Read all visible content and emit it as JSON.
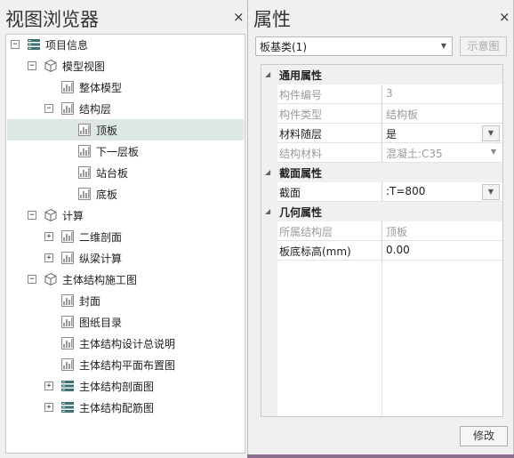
{
  "left_panel": {
    "title": "视图浏览器",
    "close": "×",
    "tree": [
      {
        "label": "项目信息",
        "depth": 0,
        "expander": "−",
        "icon": "info-list-icon"
      },
      {
        "label": "模型视图",
        "depth": 1,
        "expander": "−",
        "icon": "cube-icon"
      },
      {
        "label": "整体模型",
        "depth": 2,
        "expander": "",
        "icon": "view-icon"
      },
      {
        "label": "结构层",
        "depth": 2,
        "expander": "−",
        "icon": "view-icon"
      },
      {
        "label": "顶板",
        "depth": 3,
        "expander": "",
        "icon": "view-icon",
        "selected": true
      },
      {
        "label": "下一层板",
        "depth": 3,
        "expander": "",
        "icon": "view-icon"
      },
      {
        "label": "站台板",
        "depth": 3,
        "expander": "",
        "icon": "view-icon"
      },
      {
        "label": "底板",
        "depth": 3,
        "expander": "",
        "icon": "view-icon"
      },
      {
        "label": "计算",
        "depth": 1,
        "expander": "−",
        "icon": "cube-icon"
      },
      {
        "label": "二维剖面",
        "depth": 2,
        "expander": "+",
        "icon": "view-icon"
      },
      {
        "label": "纵梁计算",
        "depth": 2,
        "expander": "+",
        "icon": "view-icon"
      },
      {
        "label": "主体结构施工图",
        "depth": 1,
        "expander": "−",
        "icon": "cube-icon"
      },
      {
        "label": "封面",
        "depth": 2,
        "expander": "",
        "icon": "view-icon"
      },
      {
        "label": "图纸目录",
        "depth": 2,
        "expander": "",
        "icon": "view-icon"
      },
      {
        "label": "主体结构设计总说明",
        "depth": 2,
        "expander": "",
        "icon": "view-icon"
      },
      {
        "label": "主体结构平面布置图",
        "depth": 2,
        "expander": "",
        "icon": "view-icon"
      },
      {
        "label": "主体结构剖面图",
        "depth": 2,
        "expander": "+",
        "icon": "info-list-icon"
      },
      {
        "label": "主体结构配筋图",
        "depth": 2,
        "expander": "+",
        "icon": "info-list-icon"
      }
    ]
  },
  "right_panel": {
    "title": "属性",
    "close": "×",
    "type_selector": {
      "value": "板基类(1)"
    },
    "preview_button": "示意图",
    "modify_button": "修改",
    "categories": [
      {
        "name": "通用属性",
        "rows": [
          {
            "name": "构件编号",
            "value": "3",
            "editable": false
          },
          {
            "name": "构件类型",
            "value": "结构板",
            "editable": false
          },
          {
            "name": "材料随层",
            "value": "是",
            "editable": true,
            "dropdown": "button"
          },
          {
            "name": "结构材料",
            "value": "混凝土:C35",
            "editable": false,
            "dropdown": "arrow"
          }
        ]
      },
      {
        "name": "截面属性",
        "rows": [
          {
            "name": "截面",
            "value": ":T=800",
            "editable": true,
            "dropdown": "button"
          }
        ]
      },
      {
        "name": "几何属性",
        "rows": [
          {
            "name": "所属结构层",
            "value": "顶板",
            "editable": false
          },
          {
            "name": "板底标高(mm)",
            "value": "0.00",
            "editable": true
          }
        ]
      }
    ]
  },
  "colors": {
    "selection": "#dde8e6",
    "accent_bar": "#8b6f8e",
    "disabled_text": "#9b9b9b"
  }
}
